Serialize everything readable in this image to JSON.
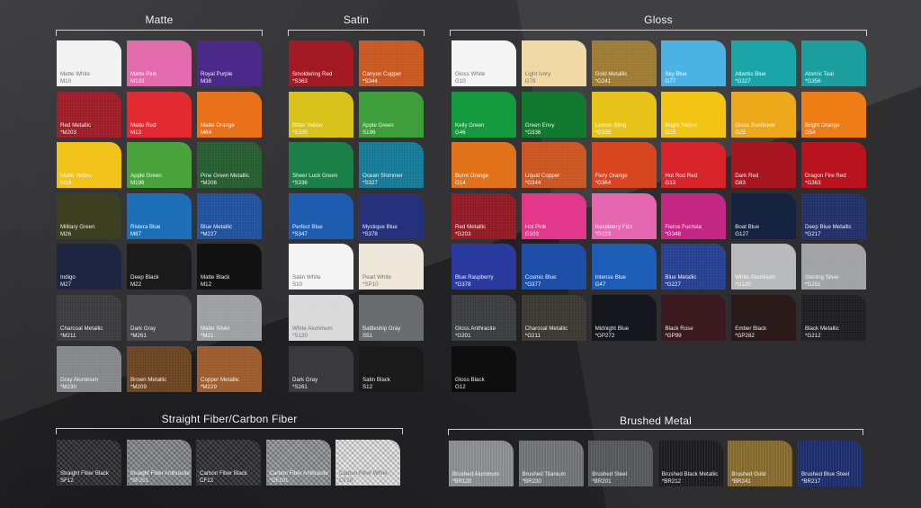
{
  "sections": {
    "matte": {
      "title": "Matte",
      "swatches": [
        {
          "name": "Matte White",
          "code": "M10",
          "color": "#f2f2f2",
          "light": true
        },
        {
          "name": "Matte Pink",
          "code": "M103",
          "color": "#e46aae"
        },
        {
          "name": "Royal Purple",
          "code": "M38",
          "color": "#4c2a8c"
        },
        {
          "name": "Red Metallic",
          "code": "*M203",
          "color": "#9c1a26"
        },
        {
          "name": "Matte Red",
          "code": "M13",
          "color": "#e22a30"
        },
        {
          "name": "Matte Orange",
          "code": "M64",
          "color": "#e8711a"
        },
        {
          "name": "Matte Yellow",
          "code": "M19",
          "color": "#f1c31a"
        },
        {
          "name": "Apple Green",
          "code": "M196",
          "color": "#4aa33a"
        },
        {
          "name": "Pine Green Metallic",
          "code": "*M206",
          "color": "#235b2e"
        },
        {
          "name": "Military Green",
          "code": "M26",
          "color": "#3c3f20"
        },
        {
          "name": "Riviera Blue",
          "code": "M87",
          "color": "#1d6fb8"
        },
        {
          "name": "Blue Metallic",
          "code": "*M227",
          "color": "#1e4f9c"
        },
        {
          "name": "Indigo",
          "code": "M27",
          "color": "#1e2540"
        },
        {
          "name": "Deep Black",
          "code": "M22",
          "color": "#1a1a1a"
        },
        {
          "name": "Matte Black",
          "code": "M12",
          "color": "#121212"
        },
        {
          "name": "Charcoal Metallic",
          "code": "*M211",
          "color": "#3a3a3c"
        },
        {
          "name": "Dark Gray",
          "code": "*M261",
          "color": "#4a4a4c"
        },
        {
          "name": "Matte Silver",
          "code": "*M21",
          "color": "#9c9ea0"
        },
        {
          "name": "Gray Aluminum",
          "code": "*M230",
          "color": "#848688"
        },
        {
          "name": "Brown Metallic",
          "code": "*M209",
          "color": "#6a4320"
        },
        {
          "name": "Copper Metallic",
          "code": "*M229",
          "color": "#9a5a2a"
        }
      ]
    },
    "satin": {
      "title": "Satin",
      "swatches": [
        {
          "name": "Smoldering Red",
          "code": "*S363",
          "color": "#a41a24"
        },
        {
          "name": "Canyon Copper",
          "code": "*S344",
          "color": "#c8561e"
        },
        {
          "name": "Bitter Yellow",
          "code": "*S335",
          "color": "#d8c21c"
        },
        {
          "name": "Apple Green",
          "code": "S196",
          "color": "#3e9e3a"
        },
        {
          "name": "Sheer Luck Green",
          "code": "*S336",
          "color": "#1a8048"
        },
        {
          "name": "Ocean Shimmer",
          "code": "*S327",
          "color": "#127896"
        },
        {
          "name": "Perfect Blue",
          "code": "*S347",
          "color": "#1e5cb0"
        },
        {
          "name": "Mystique Blue",
          "code": "*S378",
          "color": "#25317a"
        },
        {
          "name": "Satin White",
          "code": "S10",
          "color": "#f4f4f4",
          "light": true
        },
        {
          "name": "Pearl White",
          "code": "*SP10",
          "color": "#efe8da",
          "light": true
        },
        {
          "name": "White Aluminum",
          "code": "*S120",
          "color": "#d9d9d9",
          "light": true
        },
        {
          "name": "Battleship Gray",
          "code": "S51",
          "color": "#6a6c70"
        },
        {
          "name": "Dark Gray",
          "code": "*S261",
          "color": "#3a3a3e"
        },
        {
          "name": "Satin Black",
          "code": "S12",
          "color": "#1a1a1a"
        }
      ]
    },
    "gloss": {
      "title": "Gloss",
      "swatches": [
        {
          "name": "Gloss White",
          "code": "G10",
          "color": "#f4f4f4",
          "light": true
        },
        {
          "name": "Light Ivory",
          "code": "G79",
          "color": "#f1d9a6",
          "light": true
        },
        {
          "name": "Gold Metallic",
          "code": "*G241",
          "color": "#9c7a32"
        },
        {
          "name": "Sky Blue",
          "code": "G77",
          "color": "#4ab3e4"
        },
        {
          "name": "Atlantis Blue",
          "code": "*G327",
          "color": "#1aa6a8"
        },
        {
          "name": "Atomic Teal",
          "code": "*G356",
          "color": "#1c9e9e"
        },
        {
          "name": "Kelly Green",
          "code": "G46",
          "color": "#139a3c"
        },
        {
          "name": "Green Envy",
          "code": "*G336",
          "color": "#127a2e"
        },
        {
          "name": "Lemon Sting",
          "code": "*G335",
          "color": "#e8c41a"
        },
        {
          "name": "Bright Yellow",
          "code": "G15",
          "color": "#f2c515"
        },
        {
          "name": "Gloss Sunflower",
          "code": "G25",
          "color": "#eea91a"
        },
        {
          "name": "Bright Orange",
          "code": "G54",
          "color": "#ef7d15"
        },
        {
          "name": "Burnt Orange",
          "code": "G14",
          "color": "#e2731a"
        },
        {
          "name": "Liquid Copper",
          "code": "*G344",
          "color": "#c9541f"
        },
        {
          "name": "Fiery Orange",
          "code": "*G364",
          "color": "#d8461f"
        },
        {
          "name": "Hot Rod Red",
          "code": "G13",
          "color": "#d8232a"
        },
        {
          "name": "Dark Red",
          "code": "G83",
          "color": "#a9161f"
        },
        {
          "name": "Dragon Fire Red",
          "code": "*G363",
          "color": "#b8131f"
        },
        {
          "name": "Red Metallic",
          "code": "*G203",
          "color": "#8f1823"
        },
        {
          "name": "Hot Pink",
          "code": "G103",
          "color": "#e2378a"
        },
        {
          "name": "Raspberry Fizz",
          "code": "*G323",
          "color": "#e467b0"
        },
        {
          "name": "Fierce Fuchsia",
          "code": "*G348",
          "color": "#c52785"
        },
        {
          "name": "Boat Blue",
          "code": "G127",
          "color": "#152240"
        },
        {
          "name": "Deep Blue Metallic",
          "code": "*G217",
          "color": "#1f2e66"
        },
        {
          "name": "Blue Raspberry",
          "code": "*G378",
          "color": "#2a3a9e"
        },
        {
          "name": "Cosmic Blue",
          "code": "*G377",
          "color": "#1d4ea8"
        },
        {
          "name": "Intense Blue",
          "code": "G47",
          "color": "#1c5db8"
        },
        {
          "name": "Blue Metallic",
          "code": "*G227",
          "color": "#243f8f"
        },
        {
          "name": "White Aluminum",
          "code": "*G120",
          "color": "#b7b8ba"
        },
        {
          "name": "Sterling Silver",
          "code": "*G251",
          "color": "#9fa1a4"
        },
        {
          "name": "Gloss Anthracite",
          "code": "*G201",
          "color": "#3a3b3e"
        },
        {
          "name": "Charcoal Metallic",
          "code": "*G211",
          "color": "#3a3630"
        },
        {
          "name": "Midnight Blue",
          "code": "*GP272",
          "color": "#15161e"
        },
        {
          "name": "Black Rose",
          "code": "*GP99",
          "color": "#3a1a1e"
        },
        {
          "name": "Ember Black",
          "code": "*GP282",
          "color": "#2a1a1a"
        },
        {
          "name": "Black Metallic",
          "code": "*G212",
          "color": "#1c1c1e"
        },
        {
          "name": "Gloss Black",
          "code": "G12",
          "color": "#0e0e0e"
        }
      ]
    },
    "carbon": {
      "title": "Straight Fiber/Carbon Fiber",
      "swatches": [
        {
          "name": "Straight Fiber Black",
          "code": "SF12",
          "color": "#2e2e30"
        },
        {
          "name": "Straight Fiber Anthracite",
          "code": "*SF201",
          "color": "#8a8c90"
        },
        {
          "name": "Carbon Fiber Black",
          "code": "CF12",
          "color": "#303032"
        },
        {
          "name": "Carbon Fiber Anthracite",
          "code": "*CF201",
          "color": "#96989c"
        },
        {
          "name": "Carbon Fiber White",
          "code": "CF10",
          "color": "#e9e9e9",
          "light": true
        }
      ]
    },
    "brushed": {
      "title": "Brushed Metal",
      "swatches": [
        {
          "name": "Brushed Aluminum",
          "code": "*BR120",
          "color": "#8f9296"
        },
        {
          "name": "Brushed Titanium",
          "code": "*BR230",
          "color": "#76777a"
        },
        {
          "name": "Brushed Steel",
          "code": "*BR201",
          "color": "#5a5b5e"
        },
        {
          "name": "Brushed Black Metallic",
          "code": "*BR212",
          "color": "#1e1e20"
        },
        {
          "name": "Brushed Gold",
          "code": "*BR241",
          "color": "#8a6e2e"
        },
        {
          "name": "Brushed Blue Steel",
          "code": "*BR217",
          "color": "#1e3070"
        }
      ]
    }
  }
}
